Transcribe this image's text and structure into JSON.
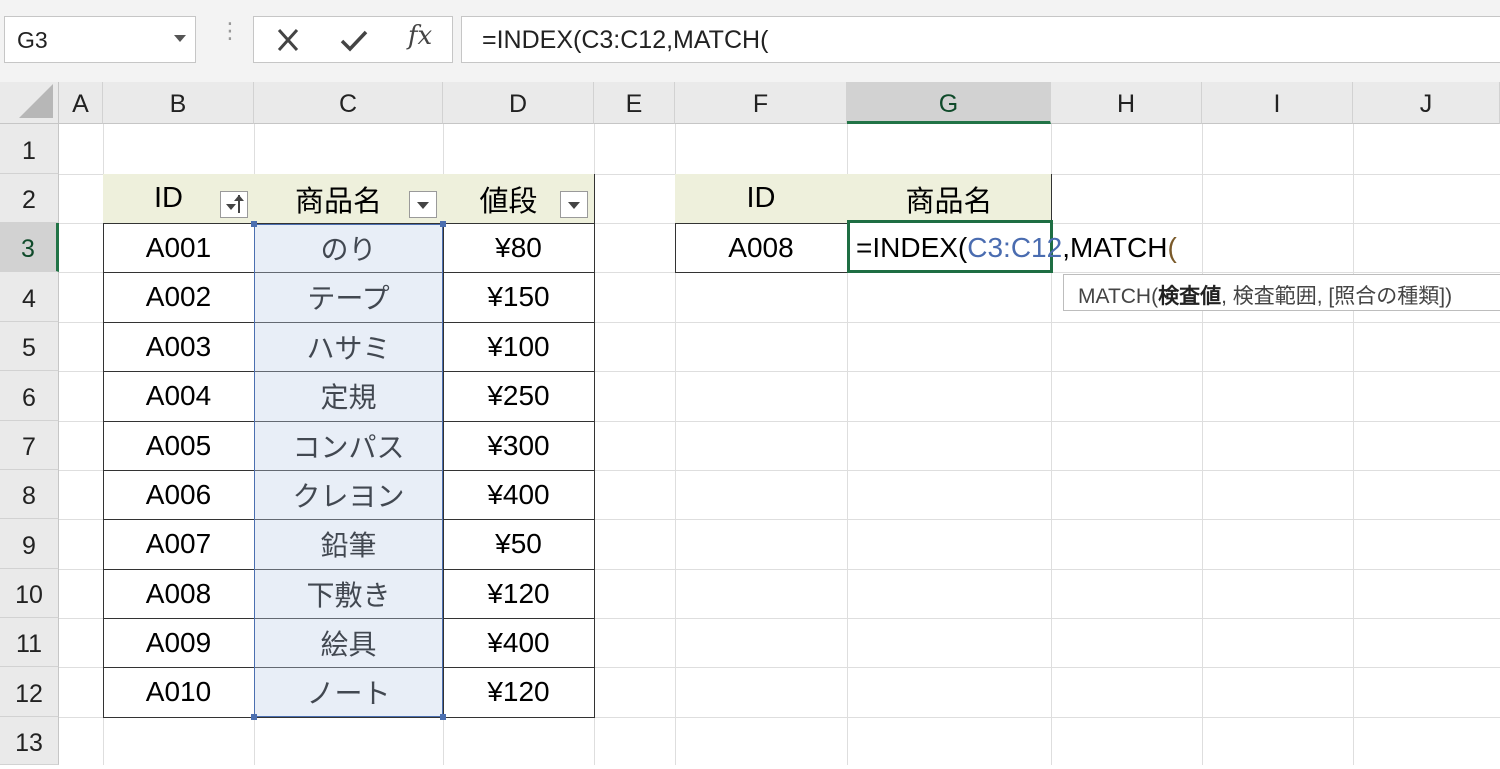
{
  "formula_bar": {
    "name_box": "G3",
    "formula": "=INDEX(C3:C12,MATCH(",
    "fx_label": "fx"
  },
  "columns": [
    "A",
    "B",
    "C",
    "D",
    "E",
    "F",
    "G",
    "H",
    "I",
    "J"
  ],
  "rows": [
    "1",
    "2",
    "3",
    "4",
    "5",
    "6",
    "7",
    "8",
    "9",
    "10",
    "11",
    "12",
    "13"
  ],
  "table_main": {
    "headers": [
      "ID",
      "商品名",
      "値段"
    ],
    "rows": [
      [
        "A001",
        "のり",
        "¥80"
      ],
      [
        "A002",
        "テープ",
        "¥150"
      ],
      [
        "A003",
        "ハサミ",
        "¥100"
      ],
      [
        "A004",
        "定規",
        "¥250"
      ],
      [
        "A005",
        "コンパス",
        "¥300"
      ],
      [
        "A006",
        "クレヨン",
        "¥400"
      ],
      [
        "A007",
        "鉛筆",
        "¥50"
      ],
      [
        "A008",
        "下敷き",
        "¥120"
      ],
      [
        "A009",
        "絵具",
        "¥400"
      ],
      [
        "A010",
        "ノート",
        "¥120"
      ]
    ]
  },
  "lookup_table": {
    "headers": [
      "ID",
      "商品名"
    ],
    "id_value": "A008"
  },
  "active_cell": {
    "part1": "=INDEX(",
    "range_ref": "C3:C12",
    "part2": ",MATCH",
    "paren": "("
  },
  "tooltip": {
    "prefix": "MATCH(",
    "bold_arg": "検査値",
    "rest": ", 検査範囲, [照合の種類])"
  },
  "colors": {
    "header_fill": "#eef0dc",
    "range_ref": "#4a6cb0",
    "selection_green": "#217346"
  }
}
